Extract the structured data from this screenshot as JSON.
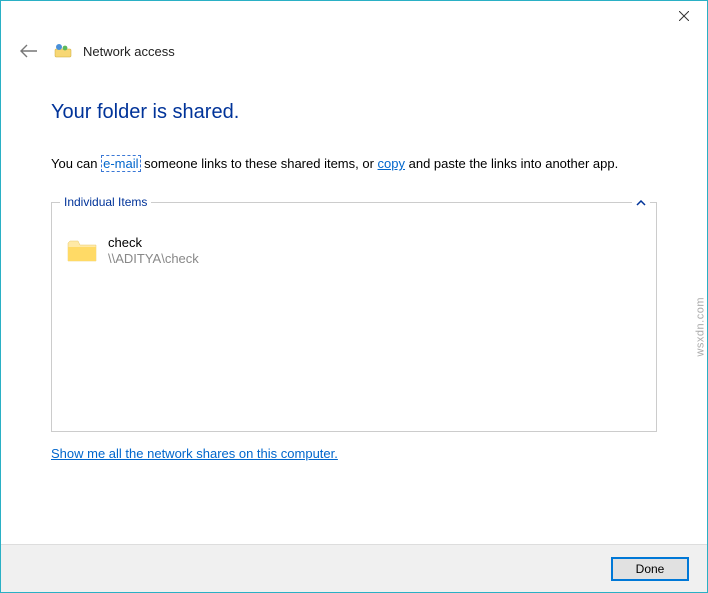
{
  "window": {
    "title": "Network access"
  },
  "heading": "Your folder is shared.",
  "body": {
    "prefix": "You can ",
    "email_link": "e-mail",
    "mid1": " someone links to these shared items, or ",
    "copy_link": "copy",
    "suffix": " and paste the links into another app."
  },
  "groupbox": {
    "legend": "Individual Items",
    "items": [
      {
        "name": "check",
        "path": "\\\\ADITYA\\check"
      }
    ]
  },
  "footer_link": "Show me all the network shares on this computer.",
  "buttons": {
    "done": "Done"
  },
  "watermark": "wsxdn.com"
}
